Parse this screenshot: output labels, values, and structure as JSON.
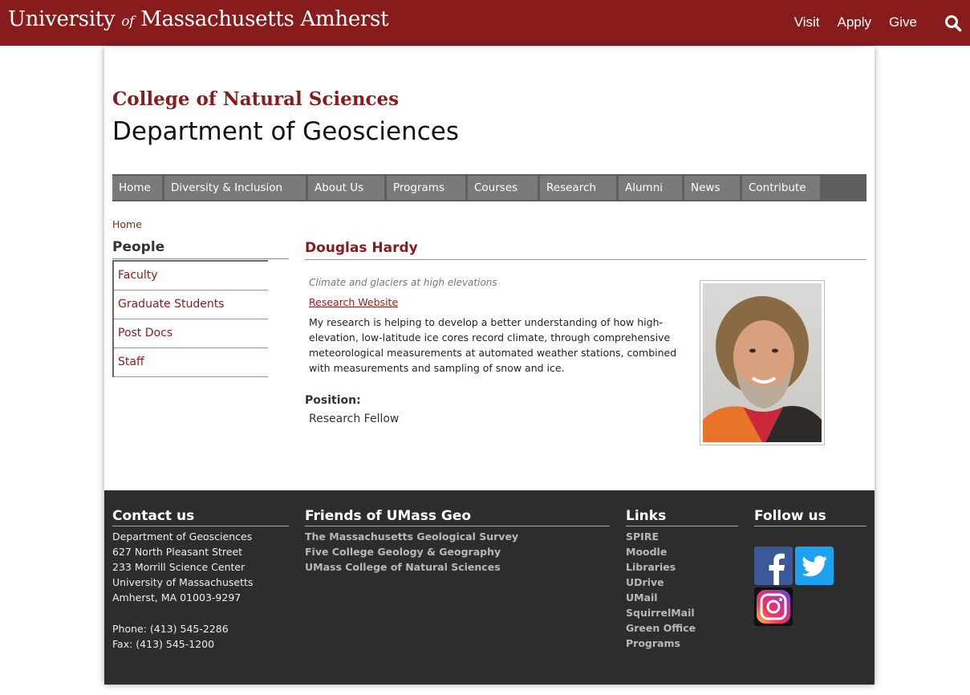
{
  "header": {
    "brand_university": "University",
    "brand_of": "of",
    "brand_place": "Massachusetts Amherst",
    "links": [
      "Visit",
      "Apply",
      "Give"
    ],
    "search_icon": "search-icon"
  },
  "site": {
    "college": "College of Natural Sciences",
    "department": "Department of Geosciences"
  },
  "nav": {
    "items": [
      "Home",
      "Diversity & Inclusion",
      "About Us",
      "Programs",
      "Courses",
      "Research",
      "Alumni",
      "News",
      "Contribute"
    ]
  },
  "breadcrumb": {
    "home": "Home"
  },
  "sidebar": {
    "title": "People",
    "items": [
      "Faculty",
      "Graduate Students",
      "Post Docs",
      "Staff"
    ]
  },
  "profile": {
    "name": "Douglas Hardy",
    "tagline": "Climate and glaciers at high elevations",
    "research_link": "Research Website",
    "bio": "My research is helping to develop a better understanding of how high-elevation, low-latitude ice cores record climate, through comprehensive meteorological measurements at automated weather stations, combined with measurements and sampling of snow and ice.",
    "position_label": "Position:",
    "position_value": "Research Fellow"
  },
  "footer": {
    "contact": {
      "title": "Contact us",
      "lines": [
        "Department of Geosciences",
        "627 North Pleasant Street",
        "233 Morrill Science Center",
        "University of Massachusetts",
        "Amherst, MA 01003-9297"
      ],
      "phone": "Phone: (413) 545-2286",
      "fax": "Fax: (413) 545-1200"
    },
    "friends": {
      "title": "Friends of UMass Geo",
      "links": [
        "The Massachusetts Geological Survey",
        "Five College Geology & Geography",
        "UMass College of Natural Sciences"
      ]
    },
    "links": {
      "title": "Links",
      "items": [
        "SPIRE",
        "Moodle",
        "Libraries",
        "UDrive",
        "UMail",
        "SquirrelMail",
        "Green Office",
        "Programs"
      ]
    },
    "follow": {
      "title": "Follow us",
      "icons": [
        "facebook-icon",
        "twitter-icon",
        "instagram-icon"
      ]
    }
  },
  "colors": {
    "brand_maroon": "#881c1c",
    "nav_bg": "#5e5e5e",
    "nav_item": "#7a7a7a",
    "footer_bg": "#2d2d2d",
    "facebook": "#3b5998",
    "twitter": "#1da1f2"
  }
}
